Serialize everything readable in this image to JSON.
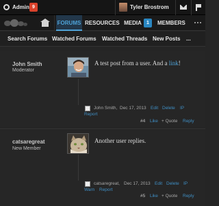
{
  "topbar": {
    "admin_label": "Admin",
    "admin_count": "9",
    "user_name": "Tyler Brostrom"
  },
  "nav": {
    "tabs": [
      {
        "label": "FORUMS"
      },
      {
        "label": "RESOURCES"
      },
      {
        "label": "MEDIA"
      },
      {
        "label": "MEMBERS"
      }
    ],
    "media_badge": "1",
    "active_color": "#4fa3d8"
  },
  "subnav": {
    "items": [
      {
        "label": "Search Forums"
      },
      {
        "label": "Watched Forums"
      },
      {
        "label": "Watched Threads"
      },
      {
        "label": "New Posts"
      },
      {
        "label": "..."
      }
    ]
  },
  "posts": [
    {
      "username": "John Smith",
      "user_title": "Moderator",
      "message_text": "A test post from a user. And a ",
      "message_link": "link",
      "message_end": "!",
      "author": "John Smith,",
      "date": "Dec 17, 2013",
      "actions": [
        "Edit",
        "Delete",
        "IP"
      ],
      "report": "Report",
      "number": "#4",
      "footer_actions": [
        "Like",
        "+ Quote",
        "Reply"
      ]
    },
    {
      "username": "catsaregreat",
      "user_title": "New Member",
      "message_text": "Another user replies.",
      "author": "catsaregreat,",
      "date": "Dec 17, 2013",
      "actions": [
        "Edit",
        "Delete",
        "IP"
      ],
      "extra_actions": [
        "Warn",
        "Report"
      ],
      "number": "#5",
      "footer_actions": [
        "Like",
        "+ Quote",
        "Reply"
      ]
    }
  ]
}
